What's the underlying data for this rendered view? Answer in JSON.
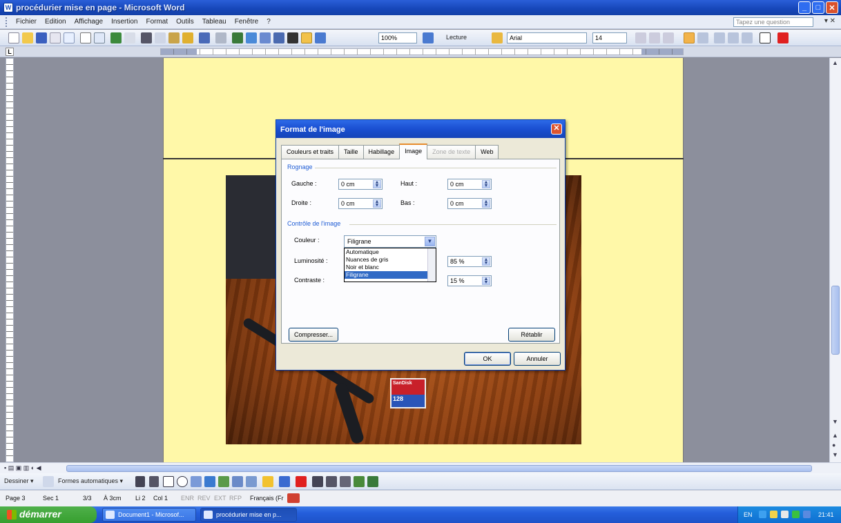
{
  "window": {
    "title": "procédurier mise en page - Microsoft Word",
    "min": "_",
    "max": "□",
    "close": "✕"
  },
  "menubar": {
    "items": [
      "Fichier",
      "Edition",
      "Affichage",
      "Insertion",
      "Format",
      "Outils",
      "Tableau",
      "Fenêtre",
      "?"
    ],
    "ask_placeholder": "Tapez une question",
    "close": "▾ ✕"
  },
  "toolbar": {
    "zoom": "100%",
    "lecture": "Lecture",
    "font": "Arial",
    "size": "14"
  },
  "dialog": {
    "title": "Format de l'image",
    "close": "✕",
    "tabs": [
      "Couleurs et traits",
      "Taille",
      "Habillage",
      "Image",
      "Zone de texte",
      "Web"
    ],
    "active_tab": "Image",
    "rognage": {
      "label": "Rognage",
      "gauche_label": "Gauche :",
      "gauche": "0 cm",
      "droite_label": "Droite :",
      "droite": "0 cm",
      "haut_label": "Haut :",
      "haut": "0 cm",
      "bas_label": "Bas :",
      "bas": "0 cm"
    },
    "controle": {
      "label": "Contrôle de l'image",
      "couleur_label": "Couleur :",
      "couleur_value": "Filigrane",
      "options": [
        "Automatique",
        "Nuances de gris",
        "Noir et blanc",
        "Filigrane"
      ],
      "luminosite_label": "Luminosité :",
      "luminosite_value": "85 %",
      "contraste_label": "Contraste :",
      "contraste_value": "15 %"
    },
    "compresser": "Compresser...",
    "retablir": "Rétablir",
    "ok": "OK",
    "annuler": "Annuler"
  },
  "photo": {
    "card_brand": "SanDisk",
    "card_size": "128"
  },
  "drawbar": {
    "dessiner": "Dessiner ▾",
    "formes": "Formes automatiques ▾"
  },
  "status": {
    "page": "Page 3",
    "sec": "Sec 1",
    "pages": "3/3",
    "at": "À 3cm",
    "li": "Li 2",
    "col": "Col 1",
    "enr": "ENR",
    "rev": "REV",
    "ext": "EXT",
    "rfp": "RFP",
    "lang": "Français (Fr"
  },
  "taskbar": {
    "start": "démarrer",
    "tasks": [
      "Document1 - Microsof...",
      "procédurier mise en p..."
    ],
    "lang": "EN",
    "clock": "21:41"
  },
  "colors": {
    "page_bg": "#fff8a8",
    "selected_option": "#316ac5",
    "group_label": "#1d5bd4"
  }
}
